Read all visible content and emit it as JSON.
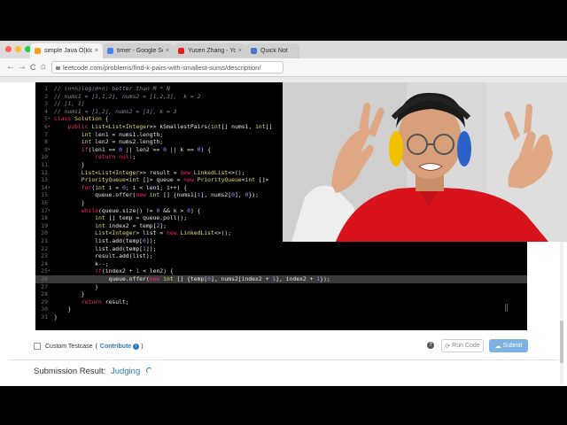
{
  "browser": {
    "window_dots": [
      "#ff5f57",
      "#febc2e",
      "#28c840"
    ],
    "tabs": [
      {
        "title": "simple Java O(klogk",
        "color": "#f89f1b",
        "active": true
      },
      {
        "title": "timer - Google Sear",
        "color": "#4285f4",
        "active": false
      },
      {
        "title": "Yusen Zhang - YouT",
        "color": "#e62117",
        "active": false
      },
      {
        "title": "Quick Not",
        "color": "#4a76d1",
        "active": false
      }
    ],
    "url": "leetcode.com/problems/find-k-pairs-with-smallest-sums/description/"
  },
  "editor": {
    "lines": [
      {
        "n": "1",
        "parts": [
          [
            "cm",
            "// (n+n)log(m+n) better than M * N"
          ]
        ]
      },
      {
        "n": "2",
        "parts": [
          [
            "cm",
            "// nums1 = [1,1,2], nums2 = [1,2,3],  k = 2"
          ]
        ]
      },
      {
        "n": "3",
        "parts": [
          [
            "cm",
            "// [1, 1]"
          ]
        ]
      },
      {
        "n": "4",
        "parts": [
          [
            "cm",
            "// nums1 = [1,2], nums2 = [3], k = 3"
          ]
        ]
      },
      {
        "n": "5",
        "fold": true,
        "parts": [
          [
            "kw",
            "class "
          ],
          [
            "cls",
            "Solution"
          ],
          [
            "",
            " {"
          ]
        ]
      },
      {
        "n": "6",
        "fold": true,
        "parts": [
          [
            "",
            "    "
          ],
          [
            "kw",
            "public "
          ],
          [
            "ty",
            "List"
          ],
          [
            "",
            "<"
          ],
          [
            "ty",
            "List"
          ],
          [
            "",
            "<"
          ],
          [
            "ty",
            "Integer"
          ],
          [
            "",
            ">> kSmallestPairs("
          ],
          [
            "ty",
            "int"
          ],
          [
            "",
            "[] nums1, "
          ],
          [
            "ty",
            "int"
          ],
          [
            "",
            "[]"
          ]
        ]
      },
      {
        "n": "7",
        "parts": [
          [
            "",
            "        "
          ],
          [
            "ty",
            "int"
          ],
          [
            "",
            " len1 = nums1.length;"
          ]
        ]
      },
      {
        "n": "8",
        "parts": [
          [
            "",
            "        "
          ],
          [
            "ty",
            "int"
          ],
          [
            "",
            " len2 = nums2.length;"
          ]
        ]
      },
      {
        "n": "9",
        "fold": true,
        "parts": [
          [
            "",
            "        "
          ],
          [
            "kw",
            "if"
          ],
          [
            "",
            "(len1 == "
          ],
          [
            "nm",
            "0"
          ],
          [
            "",
            " || len2 == "
          ],
          [
            "nm",
            "0"
          ],
          [
            "",
            " || k == "
          ],
          [
            "nm",
            "0"
          ],
          [
            "",
            ") {"
          ]
        ]
      },
      {
        "n": "10",
        "parts": [
          [
            "",
            "            "
          ],
          [
            "kw",
            "return null"
          ],
          [
            "",
            ";"
          ]
        ]
      },
      {
        "n": "11",
        "parts": [
          [
            "",
            "        }"
          ]
        ]
      },
      {
        "n": "12",
        "parts": [
          [
            "",
            "        "
          ],
          [
            "ty",
            "List"
          ],
          [
            "",
            "<"
          ],
          [
            "ty",
            "List"
          ],
          [
            "",
            "<"
          ],
          [
            "ty",
            "Integer"
          ],
          [
            "",
            ">> result = "
          ],
          [
            "kw",
            "new "
          ],
          [
            "ty",
            "LinkedList"
          ],
          [
            "",
            "<>();"
          ]
        ]
      },
      {
        "n": "13",
        "parts": [
          [
            "",
            "        "
          ],
          [
            "ty",
            "PriorityQueue"
          ],
          [
            "",
            "<"
          ],
          [
            "ty",
            "int"
          ],
          [
            "",
            " []> queue = "
          ],
          [
            "kw",
            "new "
          ],
          [
            "ty",
            "PriorityQueue"
          ],
          [
            "",
            "<"
          ],
          [
            "ty",
            "int"
          ],
          [
            "",
            " []>"
          ]
        ]
      },
      {
        "n": "14",
        "fold": true,
        "parts": [
          [
            "",
            "        "
          ],
          [
            "kw",
            "for"
          ],
          [
            "",
            "("
          ],
          [
            "ty",
            "int"
          ],
          [
            "",
            " i = "
          ],
          [
            "nm",
            "0"
          ],
          [
            "",
            "; i < len1; i++) {"
          ]
        ]
      },
      {
        "n": "15",
        "parts": [
          [
            "",
            "            queue.offer("
          ],
          [
            "kw",
            "new "
          ],
          [
            "ty",
            "int"
          ],
          [
            "",
            " [] {nums1["
          ],
          [
            "nm",
            "i"
          ],
          [
            "",
            "], nums2["
          ],
          [
            "nm",
            "0"
          ],
          [
            "",
            "], "
          ],
          [
            "nm",
            "0"
          ],
          [
            "",
            "});"
          ]
        ]
      },
      {
        "n": "16",
        "parts": [
          [
            "",
            "        }"
          ]
        ]
      },
      {
        "n": "17",
        "fold": true,
        "parts": [
          [
            "",
            "        "
          ],
          [
            "kw",
            "while"
          ],
          [
            "",
            "(queue.size() != "
          ],
          [
            "nm",
            "0"
          ],
          [
            "",
            " && k > "
          ],
          [
            "nm",
            "0"
          ],
          [
            "",
            ") {"
          ]
        ]
      },
      {
        "n": "18",
        "parts": [
          [
            "",
            "            "
          ],
          [
            "ty",
            "int"
          ],
          [
            "",
            " [] temp = queue.poll();"
          ]
        ]
      },
      {
        "n": "19",
        "parts": [
          [
            "",
            "            "
          ],
          [
            "ty",
            "int"
          ],
          [
            "",
            " index2 = temp["
          ],
          [
            "nm",
            "2"
          ],
          [
            "",
            "];"
          ]
        ]
      },
      {
        "n": "20",
        "parts": [
          [
            "",
            "            "
          ],
          [
            "ty",
            "List"
          ],
          [
            "",
            "<"
          ],
          [
            "ty",
            "Integer"
          ],
          [
            "",
            "> list = "
          ],
          [
            "kw",
            "new "
          ],
          [
            "ty",
            "LinkedList"
          ],
          [
            "",
            "<>();"
          ]
        ]
      },
      {
        "n": "21",
        "parts": [
          [
            "",
            "            list.add(temp["
          ],
          [
            "nm",
            "0"
          ],
          [
            "",
            "]);"
          ]
        ]
      },
      {
        "n": "22",
        "parts": [
          [
            "",
            "            list.add(temp["
          ],
          [
            "nm",
            "1"
          ],
          [
            "",
            "]);"
          ]
        ]
      },
      {
        "n": "23",
        "parts": [
          [
            "",
            "            result.add(list);"
          ]
        ]
      },
      {
        "n": "24",
        "parts": [
          [
            "",
            "            k--;"
          ]
        ]
      },
      {
        "n": "25",
        "fold": true,
        "parts": [
          [
            "",
            "            "
          ],
          [
            "kw",
            "if"
          ],
          [
            "",
            "(index2 + "
          ],
          [
            "nm",
            "1"
          ],
          [
            "",
            " < len2) {"
          ]
        ]
      },
      {
        "n": "26",
        "highlight": true,
        "parts": [
          [
            "",
            "                queue.offer("
          ],
          [
            "kw",
            "new "
          ],
          [
            "ty",
            "int"
          ],
          [
            "",
            " [] {temp["
          ],
          [
            "nm",
            "0"
          ],
          [
            "",
            "], nums2[index2 + "
          ],
          [
            "nm",
            "1"
          ],
          [
            "",
            "], index2 + "
          ],
          [
            "nm",
            "1"
          ],
          [
            "",
            "});"
          ]
        ]
      },
      {
        "n": "27",
        "parts": [
          [
            "",
            "            }"
          ]
        ]
      },
      {
        "n": "28",
        "parts": [
          [
            "",
            "        }"
          ]
        ]
      },
      {
        "n": "29",
        "parts": [
          [
            "",
            "        "
          ],
          [
            "kw",
            "return"
          ],
          [
            "",
            " result;"
          ]
        ]
      },
      {
        "n": "30",
        "parts": [
          [
            "",
            "    }"
          ]
        ]
      },
      {
        "n": "31",
        "parts": [
          [
            "",
            "}"
          ]
        ]
      }
    ]
  },
  "testcase": {
    "label": "Custom Testcase",
    "paren_open": "(",
    "contribute": "Contribute",
    "info_glyph": "i",
    "paren_close": ")"
  },
  "actions": {
    "help_glyph": "?",
    "run_icon": "⟳",
    "run_label": "Run Code",
    "submit_icon": "☁",
    "submit_label": "Submit"
  },
  "submission": {
    "label": "Submission Result:",
    "status": "Judging"
  },
  "icons": {
    "back": "←",
    "forward": "→",
    "reload": "C",
    "home": "⌂",
    "tab_close": "×",
    "fold": "▾"
  }
}
